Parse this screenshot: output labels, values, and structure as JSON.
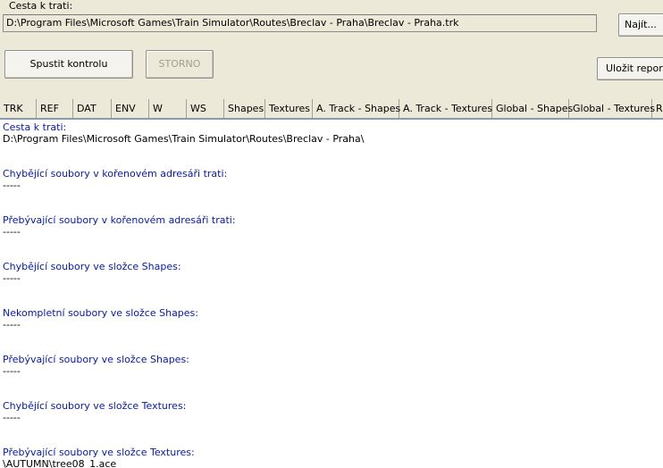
{
  "path_label": "Cesta k trati:",
  "path_value": "D:\\Program Files\\Microsoft Games\\Train Simulator\\Routes\\Breclav - Praha\\Breclav - Praha.trk",
  "buttons": {
    "find": "Najít...",
    "run": "Spustit kontrolu",
    "storno": "STORNO",
    "save": "Uložit reporty"
  },
  "tabs": [
    "TRK",
    "REF",
    "DAT",
    "ENV",
    "W",
    "WS",
    "Shapes",
    "Textures",
    "A. Track - Shapes",
    "A. Track - Textures",
    "Global - Shapes",
    "Global - Textures",
    "R"
  ],
  "report": {
    "path_heading": "Cesta k trati:",
    "path_value": "D:\\Program Files\\Microsoft Games\\Train Simulator\\Routes\\Breclav - Praha\\",
    "sections": [
      {
        "heading": "Chybějící soubory v kořenovém adresáři trati:",
        "content": "-----"
      },
      {
        "heading": "Přebývající soubory v kořenovém adresáři trati:",
        "content": "-----"
      },
      {
        "heading": "Chybějící soubory ve složce Shapes:",
        "content": "-----"
      },
      {
        "heading": "Nekompletní soubory ve složce Shapes:",
        "content": "-----"
      },
      {
        "heading": "Přebývající soubory ve složce Shapes:",
        "content": "-----"
      },
      {
        "heading": "Chybějící soubory ve složce Textures:",
        "content": "-----"
      },
      {
        "heading": "Přebývající soubory ve složce Textures:",
        "content": "\\AUTUMN\\tree08_1.ace"
      }
    ]
  },
  "colors": {
    "window_bg": "#ece9d8",
    "heading_text": "#0a1a99",
    "disabled_text": "#a19f94"
  }
}
